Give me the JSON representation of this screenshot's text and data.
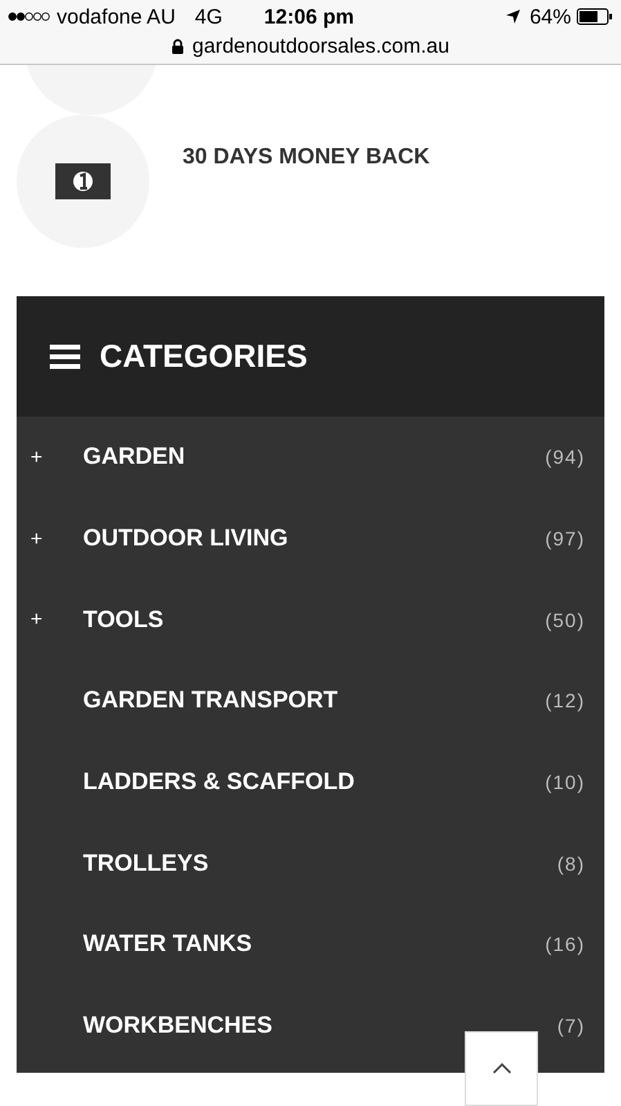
{
  "status_bar": {
    "carrier": "vodafone AU",
    "network": "4G",
    "time": "12:06 pm",
    "battery": "64%",
    "url": "gardenoutdoorsales.com.au"
  },
  "feature": {
    "label": "30 DAYS MONEY BACK"
  },
  "categories": {
    "title": "CATEGORIES",
    "items": [
      {
        "name": "GARDEN",
        "count": "(94)",
        "expand_icon": "+"
      },
      {
        "name": "OUTDOOR LIVING",
        "count": "(97)",
        "expand_icon": "+"
      },
      {
        "name": "TOOLS",
        "count": "(50)",
        "expand_icon": "+"
      },
      {
        "name": "GARDEN TRANSPORT",
        "count": "(12)"
      },
      {
        "name": "LADDERS & SCAFFOLD",
        "count": "(10)"
      },
      {
        "name": "TROLLEYS",
        "count": "(8)"
      },
      {
        "name": "WATER TANKS",
        "count": "(16)"
      },
      {
        "name": "WORKBENCHES",
        "count": "(7)"
      }
    ]
  }
}
